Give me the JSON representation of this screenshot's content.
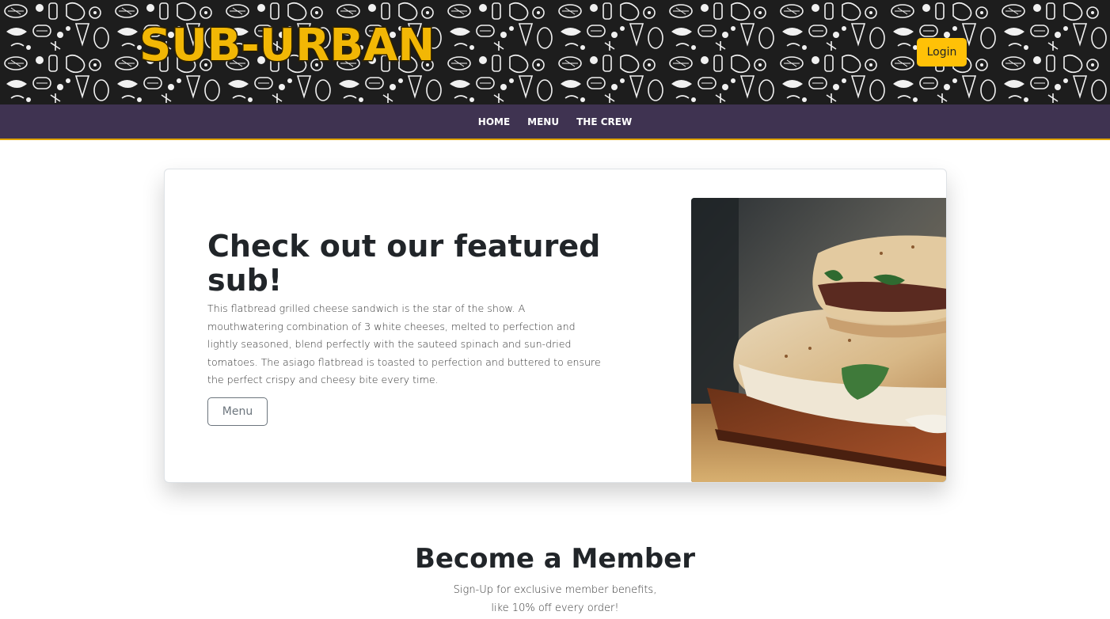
{
  "header": {
    "logo_text": "SUB-URBAN",
    "login_label": "Login",
    "accent_color": "#ffc107",
    "nav_background": "#3f3351"
  },
  "nav": {
    "items": [
      {
        "label": "HOME"
      },
      {
        "label": "MENU"
      },
      {
        "label": "THE CREW"
      }
    ]
  },
  "featured": {
    "title": "Check out our featured sub!",
    "description": "This flatbread grilled cheese sandwich is the star of the show. A mouthwatering combination of 3 white cheeses, melted to perfection and lightly seasoned, blend perfectly with the sauteed spinach and sun-dried tomatoes. The asiago flatbread is toasted to perfection and buttered to ensure the perfect crispy and cheesy bite every time.",
    "button_label": "Menu",
    "image_icon": "grilled-sandwich-photo"
  },
  "member": {
    "title": "Become a Member",
    "line1": "Sign-Up for exclusive member benefits,",
    "line2": "like 10% off every order!"
  }
}
